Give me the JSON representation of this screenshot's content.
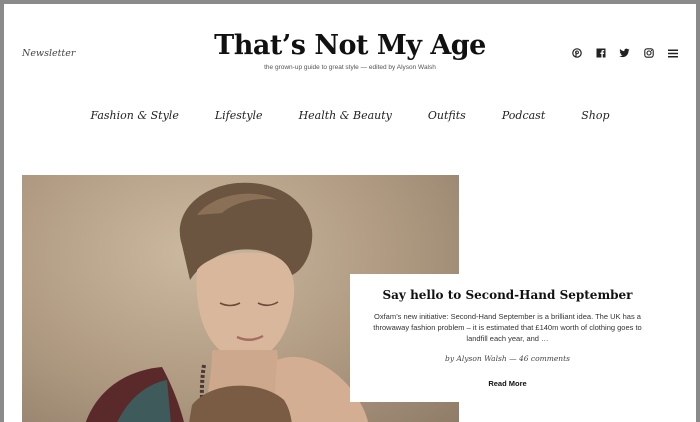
{
  "header": {
    "newsletter_label": "Newsletter",
    "site_title": "That’s Not My Age",
    "tagline": "the grown-up guide to great style — edited by Alyson Walsh"
  },
  "social_icons": [
    {
      "name": "pinterest-icon",
      "glyph": "℗"
    },
    {
      "name": "facebook-icon",
      "glyph": "f"
    },
    {
      "name": "twitter-icon",
      "glyph": "✦"
    },
    {
      "name": "instagram-icon",
      "glyph": "◎"
    },
    {
      "name": "menu-icon",
      "glyph": "≡"
    }
  ],
  "nav": {
    "items": [
      "Fashion & Style",
      "Lifestyle",
      "Health & Beauty",
      "Outfits",
      "Podcast",
      "Shop"
    ]
  },
  "featured_post": {
    "title": "Say hello to Second-Hand September",
    "excerpt": "Oxfam’s new initiative: Second-Hand September is a brilliant idea. The UK has a throwaway fashion problem  – it is estimated that £140m worth of clothing goes to landfill each year, and …",
    "byline": "by Alyson Walsh — 46 comments",
    "read_more_label": "Read More"
  },
  "colors": {
    "background": "#ffffff",
    "frame": "#8a8a8a",
    "text": "#111111"
  }
}
